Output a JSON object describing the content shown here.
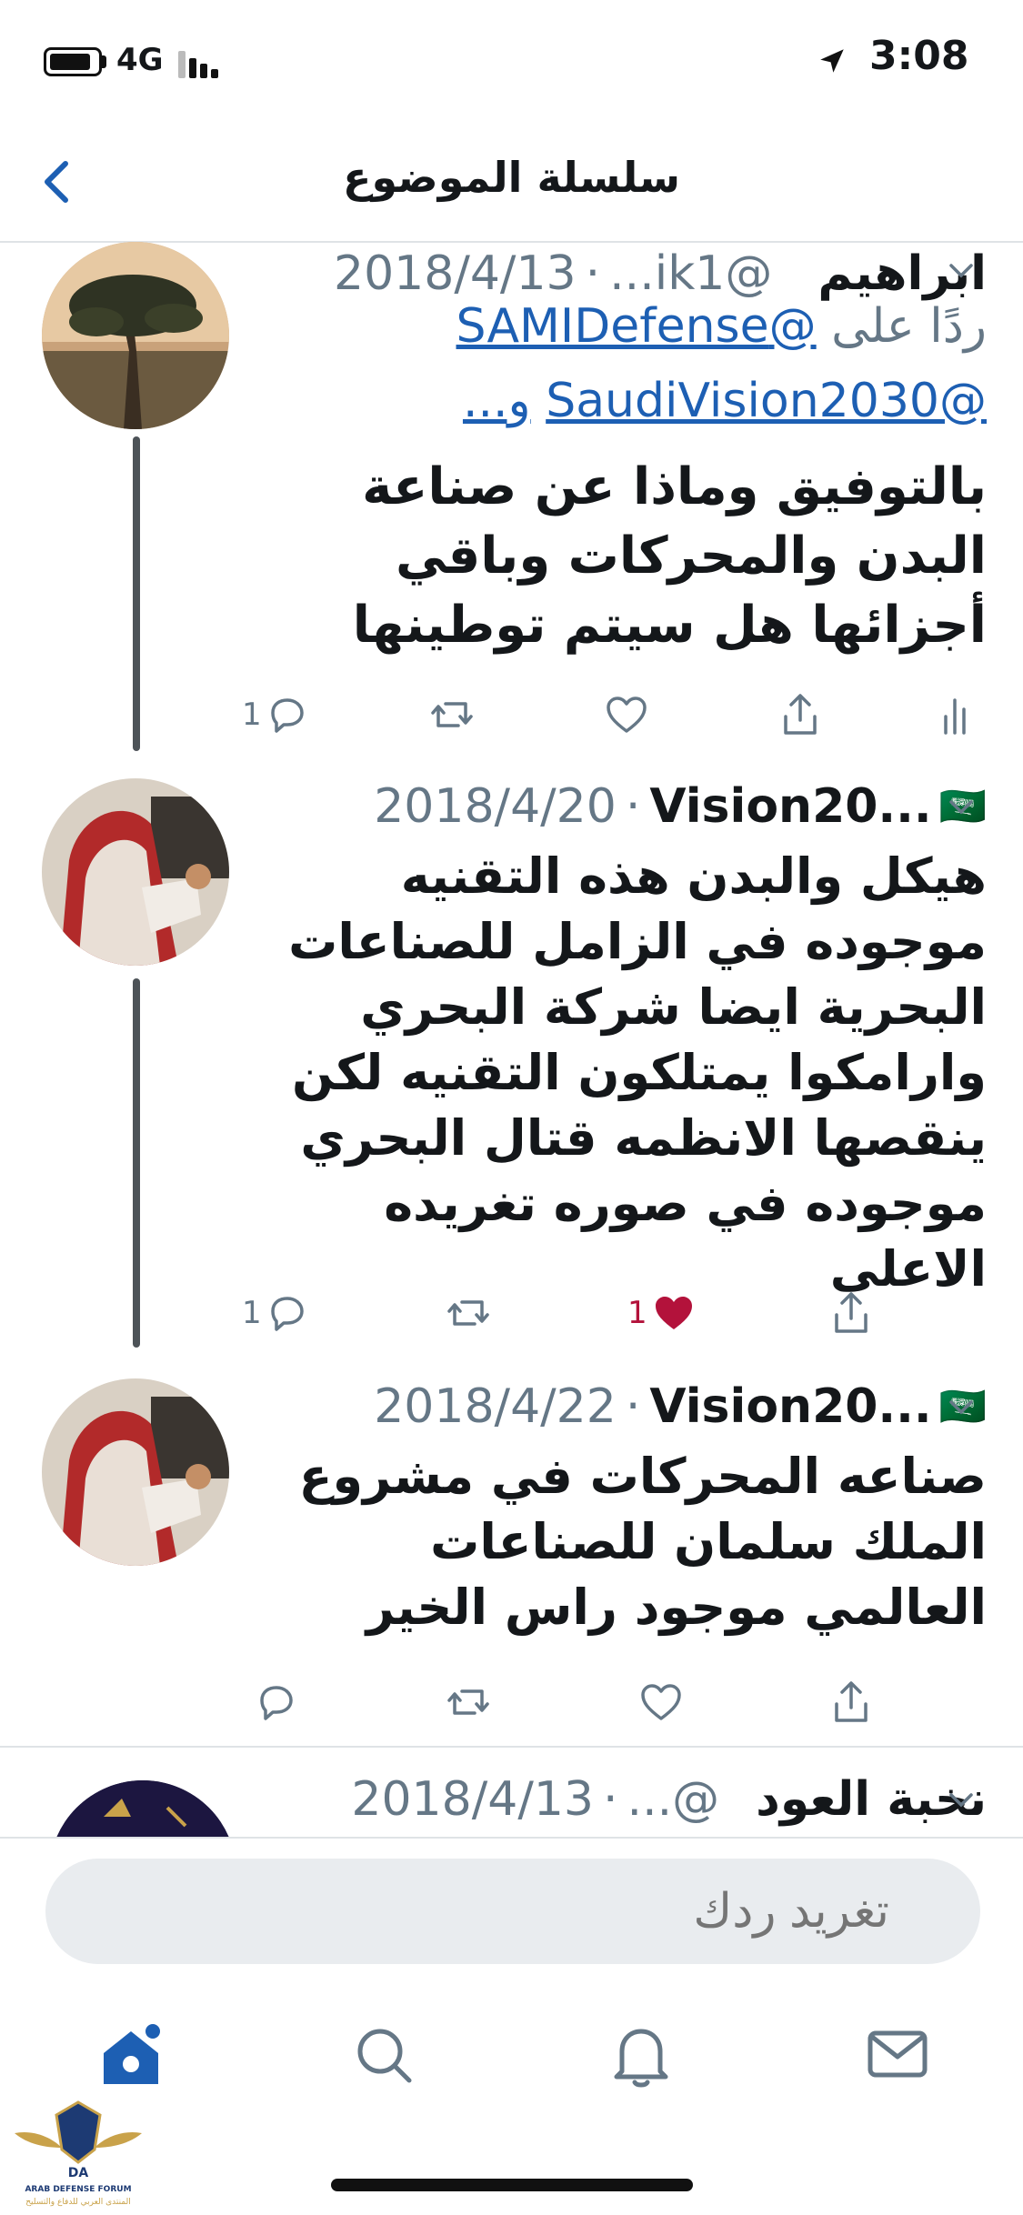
{
  "status_bar": {
    "network": "4G",
    "time": "3:08"
  },
  "header": {
    "title": "سلسلة الموضوع"
  },
  "tweets": [
    {
      "name": "ابراهيم",
      "handle": "@ik1...",
      "date": "2018/4/13",
      "reply_prefix": "ردًا على",
      "mention1": "@SAMIDefense",
      "mention2": "@SaudiVision2030",
      "mention_more": "و...",
      "text": "بالتوفيق وماذا عن صناعة البدن والمحركات وباقي أجزائها هل سيتم توطينها",
      "reply_count": "1",
      "like_count": ""
    },
    {
      "name": "Vision20...",
      "flag": "🇸🇦",
      "date": "2018/4/20",
      "text": "هيكل والبدن هذه التقنيه موجوده في الزامل للصناعات البحرية ايضا شركة البحري وارامكوا يمتلكون التقنيه لكن ينقصها الانظمه قتال البحري موجوده في صوره تغريده الاعلى",
      "reply_count": "1",
      "like_count": "1"
    },
    {
      "name": "Vision20...",
      "flag": "🇸🇦",
      "date": "2018/4/22",
      "text": "صناعه المحركات في مشروع الملك سلمان للصناعات العالمي موجود راس الخير",
      "reply_count": "",
      "like_count": ""
    },
    {
      "name": "نخبة العود",
      "handle": "@...",
      "date": "2018/4/13"
    }
  ],
  "compose": {
    "placeholder": "تغريد ردك"
  },
  "watermark": {
    "brand": "DA",
    "line1": "ARAB DEFENSE FORUM",
    "line2": "المنتدى العربي للدفاع والتسليح"
  },
  "colors": {
    "link": "#1d5fb3",
    "like": "#b3123b",
    "secondary": "#657786",
    "tab_active": "#1d5fb3"
  },
  "icons": [
    "back-chevron-icon",
    "reply-icon",
    "retweet-icon",
    "like-icon",
    "share-icon",
    "analytics-icon",
    "home-icon",
    "search-icon",
    "bell-icon",
    "mail-icon"
  ]
}
